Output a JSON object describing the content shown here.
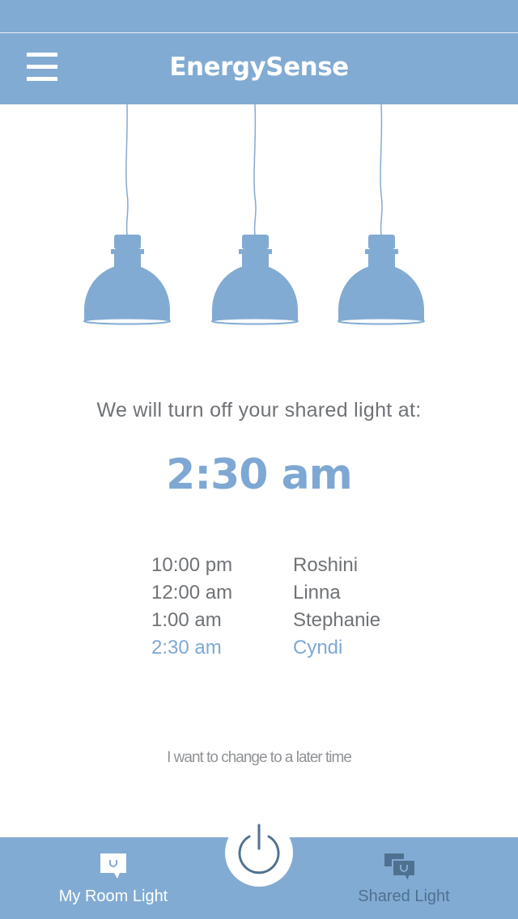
{
  "header": {
    "title": "EnergySense"
  },
  "main": {
    "headline": "We will turn off your shared light at:",
    "off_time": "2:30 am",
    "schedule": [
      {
        "time": "10:00 pm",
        "name": "Roshini",
        "active": false
      },
      {
        "time": "12:00 am",
        "name": "Linna",
        "active": false
      },
      {
        "time": "1:00 am",
        "name": "Stephanie",
        "active": false
      },
      {
        "time": "2:30 am",
        "name": "Cyndi",
        "active": true
      }
    ],
    "change_link": "I want to change to a later time"
  },
  "tabbar": {
    "my_room_label": "My Room Light",
    "shared_label": "Shared Light"
  },
  "icons": {
    "menu": "hamburger-icon",
    "lamp": "pendant-lamp-icon",
    "my_room": "chat-bubble-icon",
    "shared": "chat-bubbles-icon",
    "power": "power-icon"
  },
  "colors": {
    "accent": "#82abd3",
    "highlight": "#7ea8d3",
    "text": "#6f7276",
    "inactive_tab": "#4f7190"
  }
}
